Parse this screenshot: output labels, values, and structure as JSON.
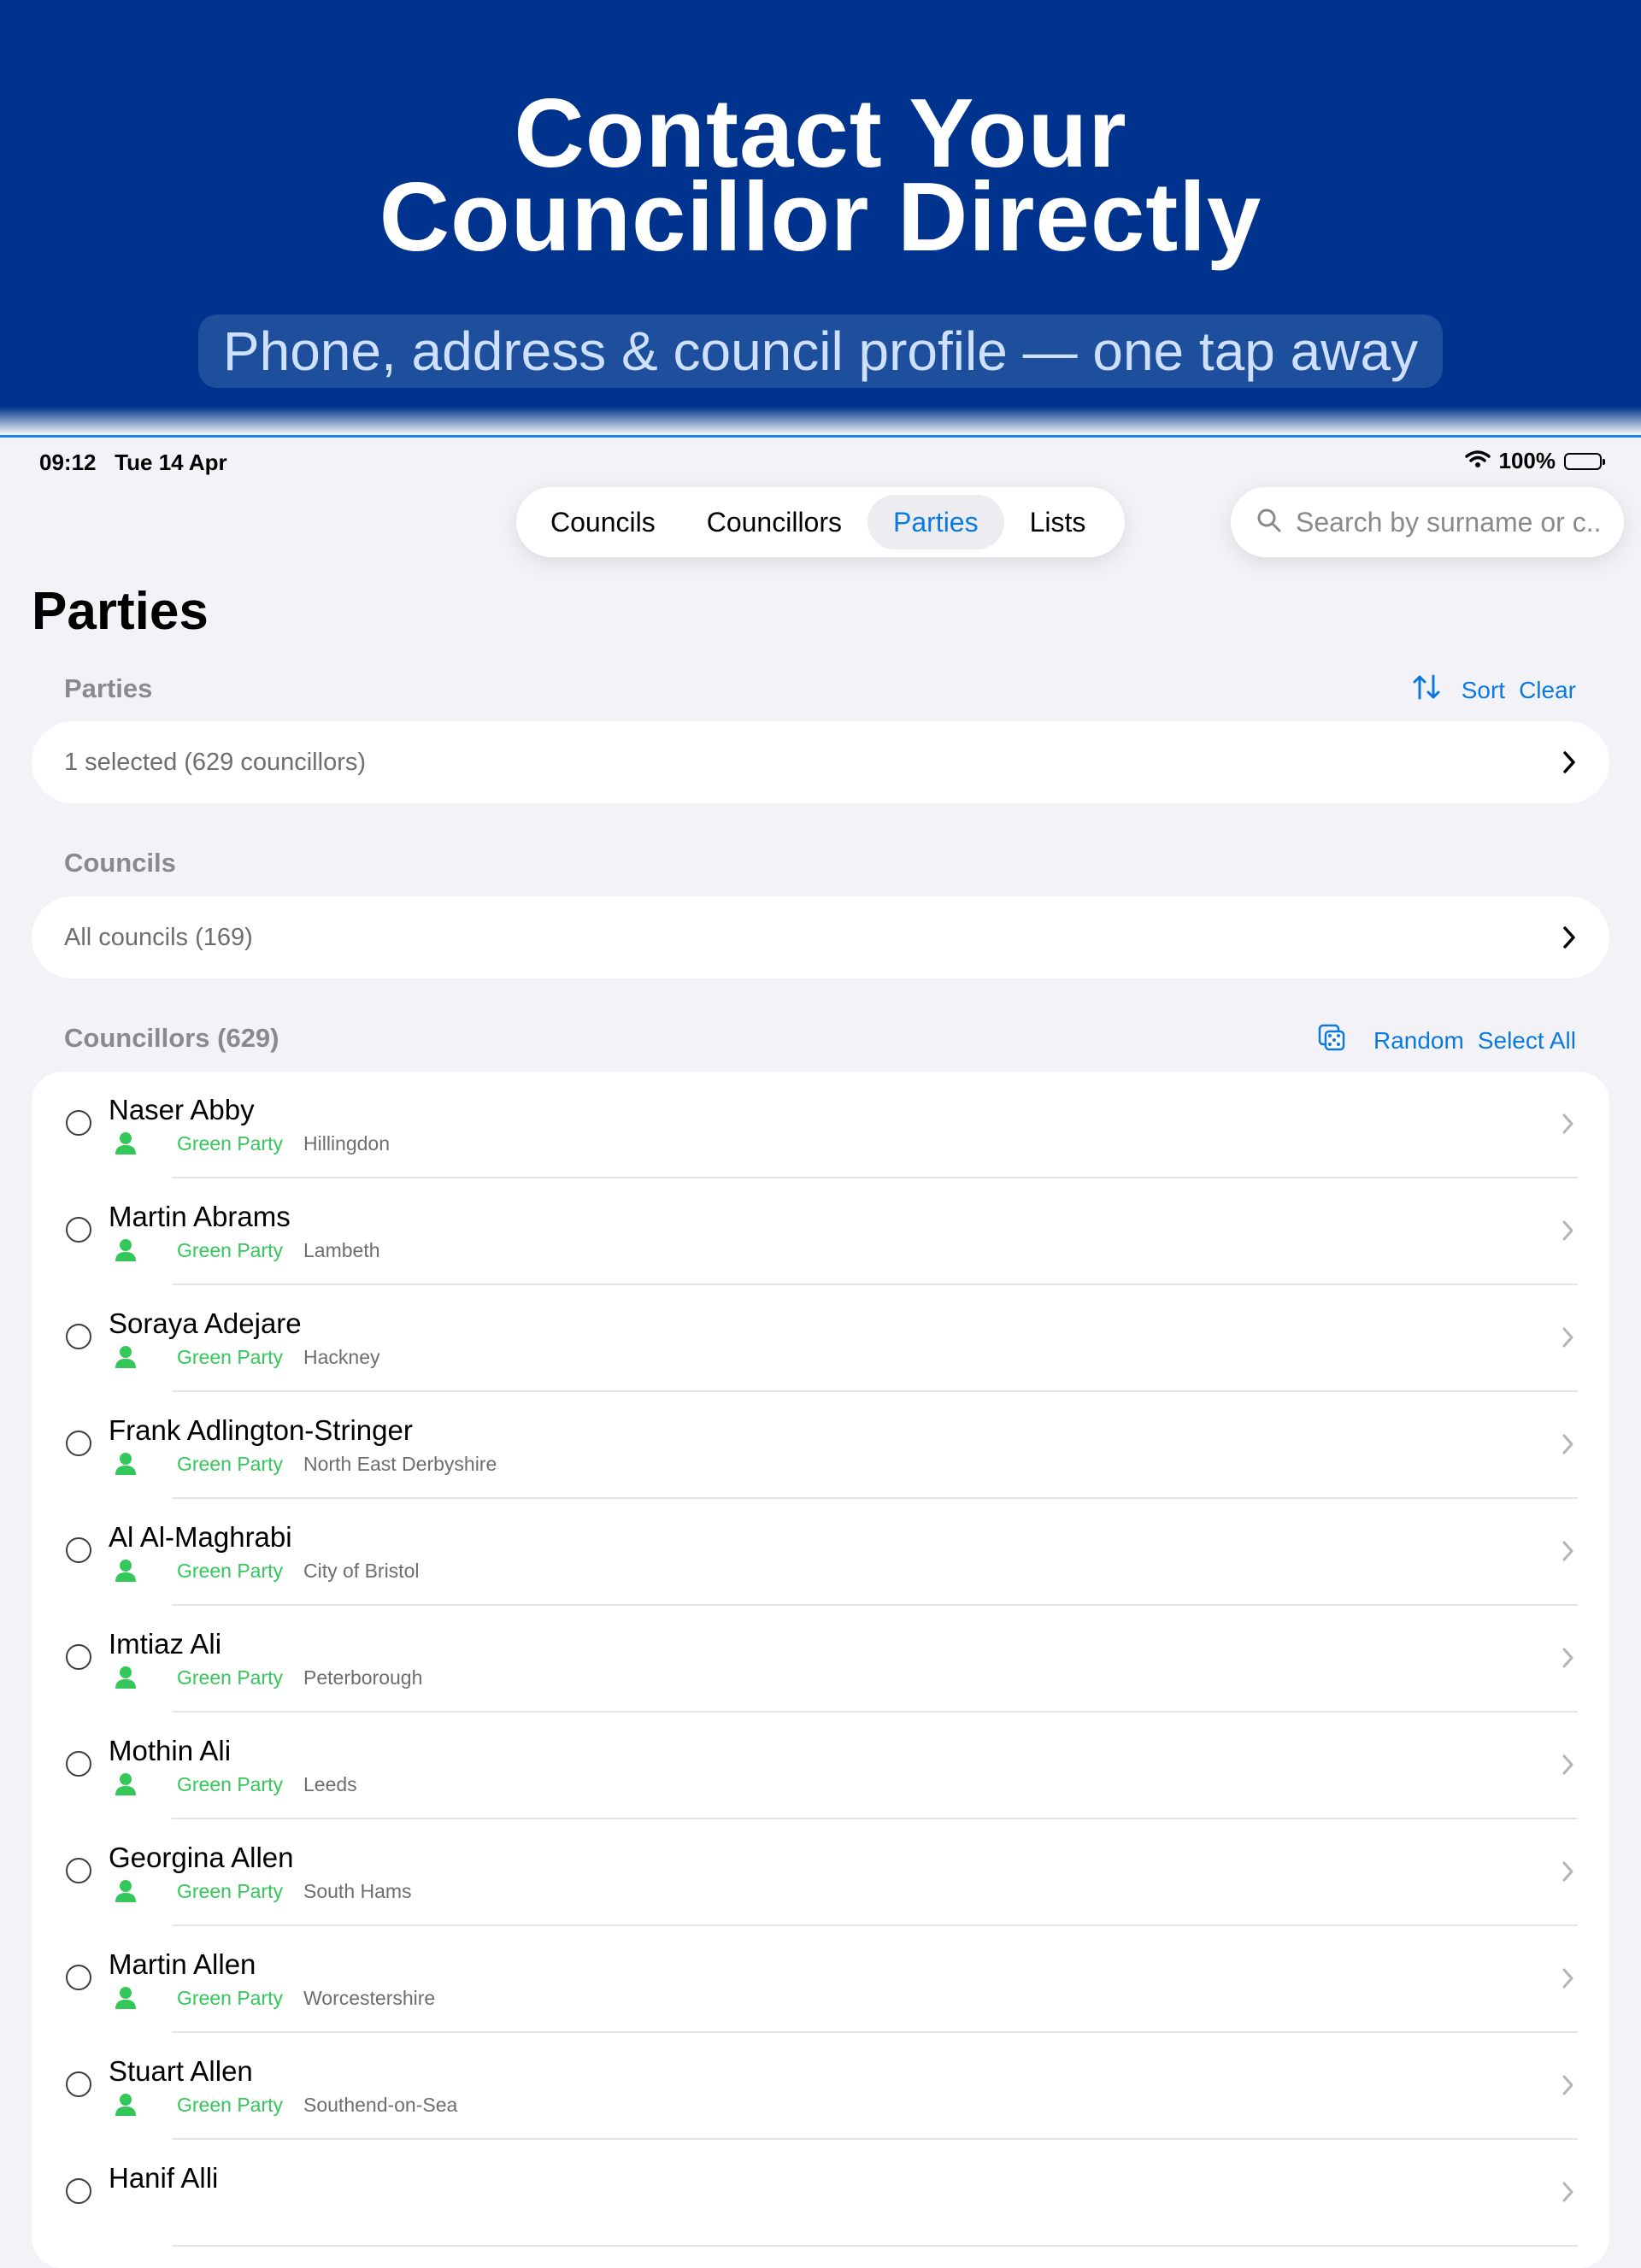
{
  "banner": {
    "title_line1": "Contact Your",
    "title_line2": "Councillor Directly",
    "subtitle": "Phone, address & council profile — one tap away"
  },
  "status_bar": {
    "time": "09:12",
    "date": "Tue 14 Apr",
    "battery": "100%"
  },
  "tabs": [
    {
      "label": "Councils",
      "active": false
    },
    {
      "label": "Councillors",
      "active": false
    },
    {
      "label": "Parties",
      "active": true
    },
    {
      "label": "Lists",
      "active": false
    }
  ],
  "search": {
    "placeholder": "Search by surname or c..."
  },
  "page_title": "Parties",
  "parties_section": {
    "label": "Parties",
    "sort_label": "Sort",
    "clear_label": "Clear",
    "summary": "1 selected (629 councillors)"
  },
  "councils_section": {
    "label": "Councils",
    "summary": "All councils (169)"
  },
  "councillors_section": {
    "label": "Councillors (629)",
    "random_label": "Random",
    "select_all_label": "Select All"
  },
  "councillors": [
    {
      "name": "Naser Abby",
      "party": "Green Party",
      "council": "Hillingdon"
    },
    {
      "name": "Martin Abrams",
      "party": "Green Party",
      "council": "Lambeth"
    },
    {
      "name": "Soraya Adejare",
      "party": "Green Party",
      "council": "Hackney"
    },
    {
      "name": "Frank Adlington-Stringer",
      "party": "Green Party",
      "council": "North East Derbyshire"
    },
    {
      "name": "Al Al-Maghrabi",
      "party": "Green Party",
      "council": "City of Bristol"
    },
    {
      "name": "Imtiaz Ali",
      "party": "Green Party",
      "council": "Peterborough"
    },
    {
      "name": "Mothin Ali",
      "party": "Green Party",
      "council": "Leeds"
    },
    {
      "name": "Georgina Allen",
      "party": "Green Party",
      "council": "South Hams"
    },
    {
      "name": "Martin Allen",
      "party": "Green Party",
      "council": "Worcestershire"
    },
    {
      "name": "Stuart Allen",
      "party": "Green Party",
      "council": "Southend-on-Sea"
    },
    {
      "name": "Hanif Alli",
      "party": "",
      "council": ""
    }
  ],
  "colors": {
    "accent": "#0a7ae0",
    "banner": "#00338d",
    "party_green": "#34c759"
  }
}
